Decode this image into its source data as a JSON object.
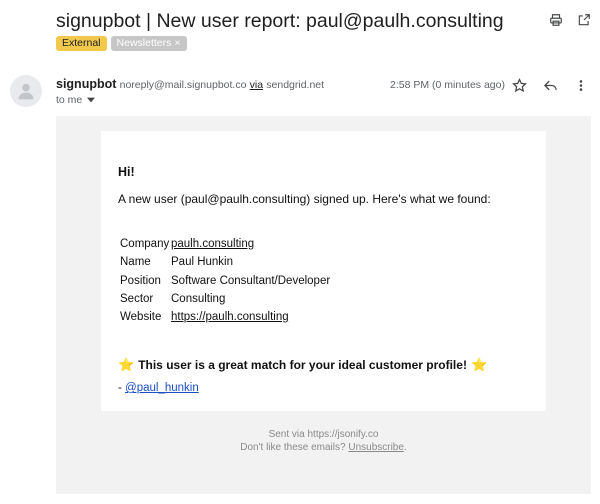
{
  "email": {
    "subject": "signupbot | New user report: paul@paulh.consulting",
    "labels": [
      "External",
      "Newsletters"
    ],
    "label_remove_glyph": "×",
    "sender_name": "signupbot",
    "sender_email": "noreply@mail.signupbot.co",
    "via_word": "via",
    "via_domain": "sendgrid.net",
    "recipient_label": "to me",
    "time": "2:58 PM (0 minutes ago)"
  },
  "icons": [
    "printer-icon",
    "open-new-window-icon",
    "avatar-person-icon",
    "star-icon",
    "reply-icon",
    "more-vert-icon",
    "chevron-down-icon"
  ],
  "body": {
    "greeting": "Hi!",
    "intro": "A new user (paul@paulh.consulting) signed up. Here's what we found:",
    "fields": [
      {
        "key": "Company",
        "value": "paulh.consulting"
      },
      {
        "key": "Name",
        "value": "Paul Hunkin"
      },
      {
        "key": "Position",
        "value": "Software Consultant/Developer"
      },
      {
        "key": "Sector",
        "value": "Consulting"
      },
      {
        "key": "Website",
        "value": "https://paulh.consulting"
      }
    ],
    "match_text": "This user is a great match for your ideal customer profile!",
    "star_glyph": "⭐",
    "handle_prefix": "-",
    "handle": "@paul_hunkin"
  },
  "footer": {
    "sent_via": "Sent via https://jsonify.co",
    "dislike_text": "Don't like these emails?",
    "unsubscribe": "Unsubscribe",
    "end_period": "."
  },
  "colors": {
    "external_label": "#f2c94c",
    "newsletter_label": "#c6c6c6",
    "email_background": "#f2f2f2",
    "link": "#1a4ec6"
  }
}
